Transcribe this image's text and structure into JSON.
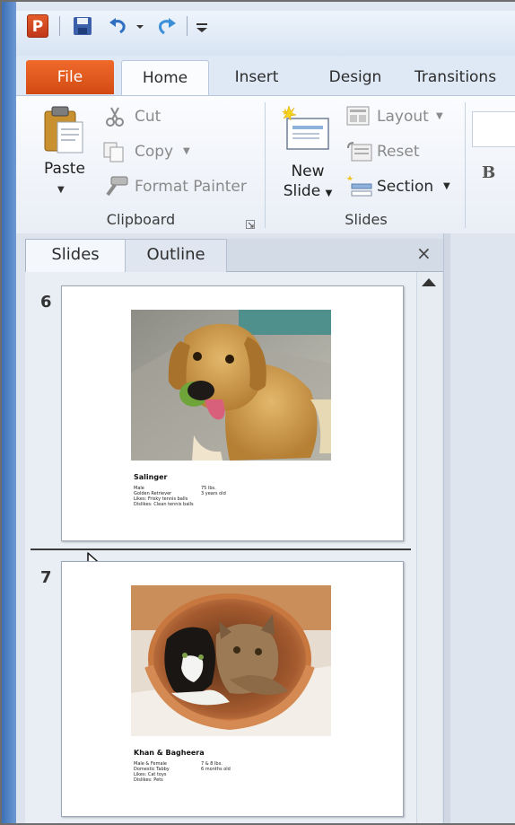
{
  "window": {
    "app_icon_letter": "P"
  },
  "tabs": [
    "File",
    "Home",
    "Insert",
    "Design",
    "Transitions"
  ],
  "clipboard": {
    "group_label": "Clipboard",
    "paste_label": "Paste",
    "cut_label": "Cut",
    "copy_label": "Copy",
    "format_painter_label": "Format Painter"
  },
  "slides_group": {
    "group_label": "Slides",
    "new_slide_line1": "New",
    "new_slide_line2": "Slide",
    "layout_label": "Layout",
    "reset_label": "Reset",
    "section_label": "Section"
  },
  "font_group": {
    "bold_label": "B"
  },
  "panel": {
    "tab_slides": "Slides",
    "tab_outline": "Outline",
    "close_label": "×"
  },
  "slides": [
    {
      "number": "6",
      "title": "Salinger",
      "lines": [
        "Male",
        "Golden Retriever",
        "Likes: Frisky tennis balls",
        "Dislikes: Clean tennis balls"
      ],
      "right_lines": [
        "75 lbs.",
        "3 years old"
      ]
    },
    {
      "number": "7",
      "title": "Khan & Bagheera",
      "lines": [
        "Male & Female",
        "Domestic Tabby",
        "Likes: Cat toys",
        "Dislikes: Pets"
      ],
      "right_lines": [
        "7 & 8 lbs.",
        "6 months old"
      ]
    }
  ],
  "colors": {
    "file_tab": "#e0561c",
    "ribbon_bg": "#f3f6fb",
    "panel_bg": "#dde3ec"
  }
}
